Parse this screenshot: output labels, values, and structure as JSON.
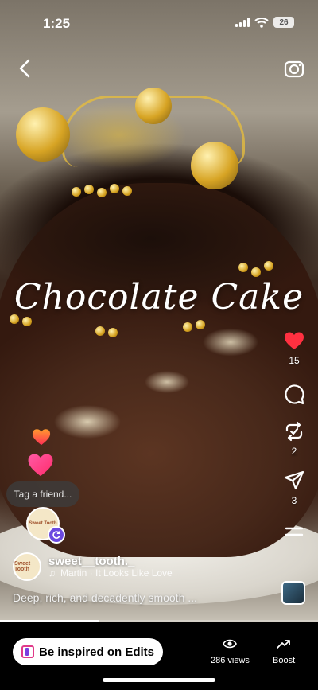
{
  "status_bar": {
    "time": "1:25",
    "battery": "26"
  },
  "overlay": {
    "title": "Chocolate Cake"
  },
  "actions": {
    "likes": "15",
    "comments": "",
    "reposts": "2",
    "shares": "3"
  },
  "tag": {
    "label": "Tag a friend..."
  },
  "author": {
    "username": "sweet__tooth._",
    "audio": "Martin · It Looks Like Love",
    "avatar_text": "Sweet Tooth"
  },
  "caption": "Deep, rich, and decadently smooth ...",
  "playback": {
    "progress": 0.31
  },
  "bottom": {
    "edits_label": "Be inspired on Edits",
    "views_label": "286 views",
    "boost_label": "Boost"
  },
  "colors": {
    "like": "#ff3040",
    "badge": "#6b49e0"
  }
}
